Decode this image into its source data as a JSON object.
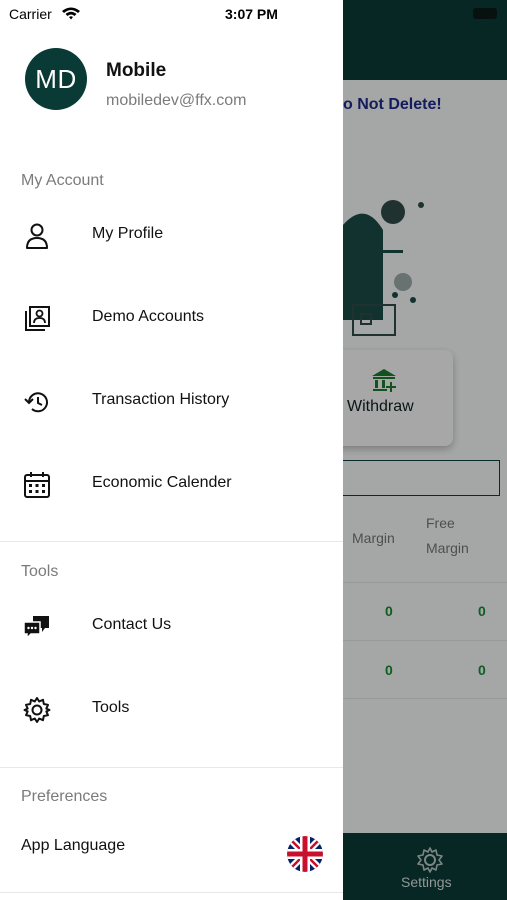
{
  "status_bar": {
    "carrier": "Carrier",
    "time": "3:07 PM"
  },
  "background": {
    "notice": "o Not Delete!",
    "withdraw_label": "Withdraw",
    "columns": {
      "margin": "Margin",
      "free_margin_line1": "Free",
      "free_margin_line2": "Margin"
    },
    "rows": [
      [
        "0",
        "0"
      ],
      [
        "0",
        "0"
      ]
    ],
    "bottom_tab": {
      "settings_label": "Settings",
      "icon": "gear-icon"
    },
    "colors": {
      "header": "#093a36",
      "accent": "#178a30",
      "notice": "#1e2a8a"
    }
  },
  "drawer": {
    "user": {
      "initials": "MD",
      "name": "Mobile",
      "email": "mobiledev@ffx.com"
    },
    "sections": [
      {
        "title": "My Account",
        "items": [
          {
            "label": "My Profile",
            "icon": "person-icon"
          },
          {
            "label": "Demo Accounts",
            "icon": "accounts-icon"
          },
          {
            "label": "Transaction History",
            "icon": "history-icon"
          },
          {
            "label": "Economic Calender",
            "icon": "calendar-icon"
          }
        ]
      },
      {
        "title": "Tools",
        "items": [
          {
            "label": "Contact Us",
            "icon": "chat-icon"
          },
          {
            "label": "Tools",
            "icon": "gear-icon"
          }
        ]
      },
      {
        "title": "Preferences",
        "items": [
          {
            "label": "App Language",
            "icon": "uk-flag-icon"
          }
        ]
      }
    ]
  }
}
